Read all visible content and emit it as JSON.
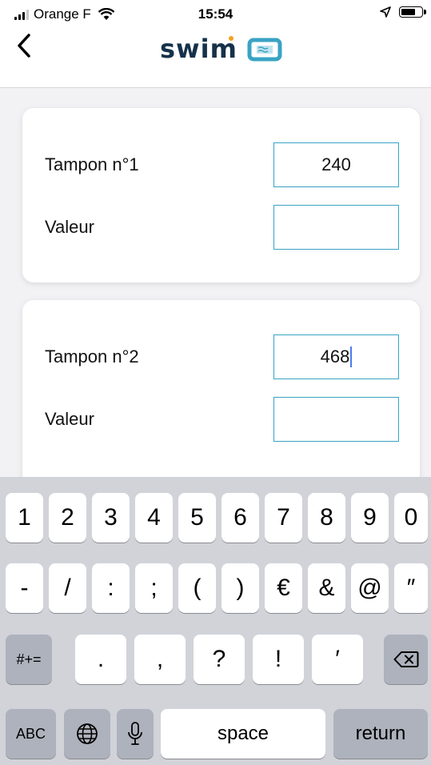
{
  "status_bar": {
    "carrier": "Orange F",
    "time": "15:54"
  },
  "nav": {
    "logo_text": "swim"
  },
  "cards": [
    {
      "tampon_label": "Tampon n°1",
      "tampon_value": "240",
      "valeur_label": "Valeur",
      "valeur_value": ""
    },
    {
      "tampon_label": "Tampon n°2",
      "tampon_value": "468",
      "valeur_label": "Valeur",
      "valeur_value": ""
    }
  ],
  "keyboard": {
    "row1": [
      "1",
      "2",
      "3",
      "4",
      "5",
      "6",
      "7",
      "8",
      "9",
      "0"
    ],
    "row2": [
      "-",
      "/",
      ":",
      ";",
      "(",
      ")",
      "€",
      "&",
      "@",
      "″"
    ],
    "row3_left": "#+=",
    "row3_keys": [
      ".",
      ",",
      "?",
      "!",
      "′"
    ],
    "abc_label": "ABC",
    "space_label": "space",
    "return_label": "return"
  },
  "colors": {
    "field_border": "#3aa3c4",
    "caret": "#4f7bf0",
    "keyboard_bg": "#d1d3d9"
  }
}
